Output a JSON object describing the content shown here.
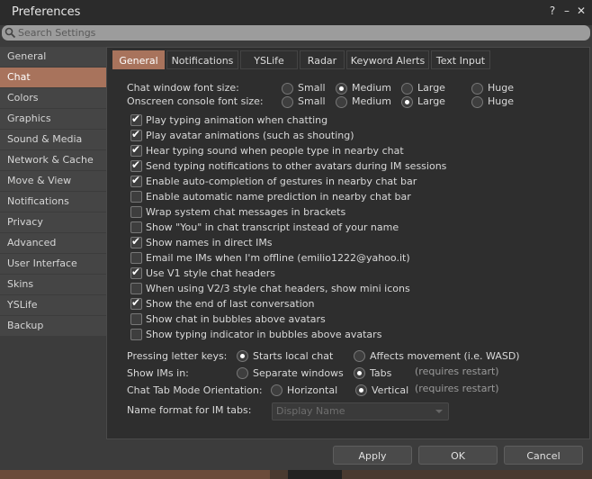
{
  "window": {
    "title": "Preferences",
    "help_icon": "?",
    "minimize_icon": "–",
    "close_icon": "✕"
  },
  "search": {
    "placeholder": "Search Settings"
  },
  "sidebar": {
    "items": [
      {
        "label": "General"
      },
      {
        "label": "Chat"
      },
      {
        "label": "Colors"
      },
      {
        "label": "Graphics"
      },
      {
        "label": "Sound & Media"
      },
      {
        "label": "Network & Cache"
      },
      {
        "label": "Move & View"
      },
      {
        "label": "Notifications"
      },
      {
        "label": "Privacy"
      },
      {
        "label": "Advanced"
      },
      {
        "label": "User Interface"
      },
      {
        "label": "Skins"
      },
      {
        "label": "YSLife"
      },
      {
        "label": "Backup"
      }
    ],
    "active": "Chat"
  },
  "tabs": [
    {
      "label": "General"
    },
    {
      "label": "Notifications"
    },
    {
      "label": "YSLife"
    },
    {
      "label": "Radar"
    },
    {
      "label": "Keyword Alerts"
    },
    {
      "label": "Text Input"
    }
  ],
  "font_size": {
    "chat_label": "Chat window font size:",
    "console_label": "Onscreen console font size:",
    "options": [
      "Small",
      "Medium",
      "Large",
      "Huge"
    ],
    "chat_selected": "Medium",
    "console_selected": "Large"
  },
  "checkboxes": [
    {
      "label": "Play typing animation when chatting",
      "checked": true
    },
    {
      "label": "Play avatar animations (such as shouting)",
      "checked": true
    },
    {
      "label": "Hear typing sound when people type in nearby chat",
      "checked": true
    },
    {
      "label": "Send typing notifications to other avatars during IM sessions",
      "checked": true
    },
    {
      "label": "Enable auto-completion of gestures in nearby chat bar",
      "checked": true
    },
    {
      "label": "Enable automatic name prediction in nearby chat bar",
      "checked": false
    },
    {
      "label": "Wrap system chat messages in brackets",
      "checked": false
    },
    {
      "label": "Show \"You\" in chat transcript instead of your name",
      "checked": false
    },
    {
      "label": "Show names in direct IMs",
      "checked": true
    },
    {
      "label": "Email me IMs when I'm offline (emilio1222@yahoo.it)",
      "checked": false
    },
    {
      "label": "Use V1 style chat headers",
      "checked": true
    },
    {
      "label": "When using V2/3 style chat headers, show mini icons",
      "checked": false
    },
    {
      "label": "Show the end of last conversation",
      "checked": true
    },
    {
      "label": "Show chat in bubbles above avatars",
      "checked": false
    },
    {
      "label": "Show typing indicator in bubbles above avatars",
      "checked": false
    }
  ],
  "letter_keys": {
    "label": "Pressing letter keys:",
    "options": [
      "Starts local chat",
      "Affects movement (i.e. WASD)"
    ],
    "selected": "Starts local chat"
  },
  "show_ims": {
    "label": "Show IMs in:",
    "options": [
      "Separate windows",
      "Tabs"
    ],
    "selected": "Tabs",
    "hint": "(requires restart)"
  },
  "tab_orientation": {
    "label": "Chat Tab Mode Orientation:",
    "options": [
      "Horizontal",
      "Vertical"
    ],
    "selected": "Vertical",
    "hint": "(requires restart)"
  },
  "name_format": {
    "label": "Name format for IM tabs:",
    "value": "Display Name"
  },
  "buttons": {
    "apply": "Apply",
    "ok": "OK",
    "cancel": "Cancel"
  }
}
